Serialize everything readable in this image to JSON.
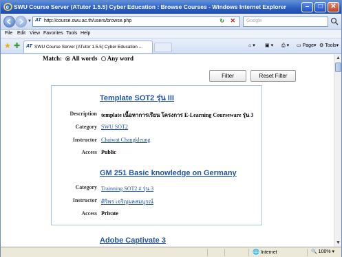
{
  "window": {
    "title": "SWU Course Server (ATutor 1.5.5) Cyber Education : Browse Courses - Windows Internet Explorer",
    "minimize": "–",
    "maximize": "□",
    "close": "✕"
  },
  "address": {
    "favicon": "AT",
    "url": "http://course.swu.ac.th/users/browse.php",
    "search_placeholder": "Google"
  },
  "menu": [
    "File",
    "Edit",
    "View",
    "Favorites",
    "Tools",
    "Help"
  ],
  "tab": {
    "label": "SWU Course Server (ATutor 1.5.5) Cyber Education ..."
  },
  "commands": {
    "page": "Page",
    "tools": "Tools"
  },
  "filter": {
    "match_label": "Match:",
    "all_words": "All words",
    "any_word": "Any word",
    "selected": "all_words",
    "filter_button": "Filter",
    "reset_button": "Reset Filter"
  },
  "courses": [
    {
      "title": "Template SOT2 รุ่น III",
      "description_label": "Description",
      "description": "template เนื้อหาการเรียน โครงการ E-Learning Courseware รุ่น 3",
      "category_label": "Category",
      "category": "SWU SOT2",
      "instructor_label": "Instructor",
      "instructor": "Chaiwat Changkleung",
      "access_label": "Access",
      "access": "Public"
    },
    {
      "title": "GM 251 Basic knowledge on Germany",
      "category_label": "Category",
      "category": "Trainning SOT2 # รุ่น 3",
      "instructor_label": "Instructor",
      "instructor": "ศิริพร เจริญผลสมบูรณ์",
      "access_label": "Access",
      "access": "Private"
    },
    {
      "title": "Adobe Captivate 3"
    }
  ],
  "status": {
    "zone": "Internet",
    "zoom": "100%"
  }
}
